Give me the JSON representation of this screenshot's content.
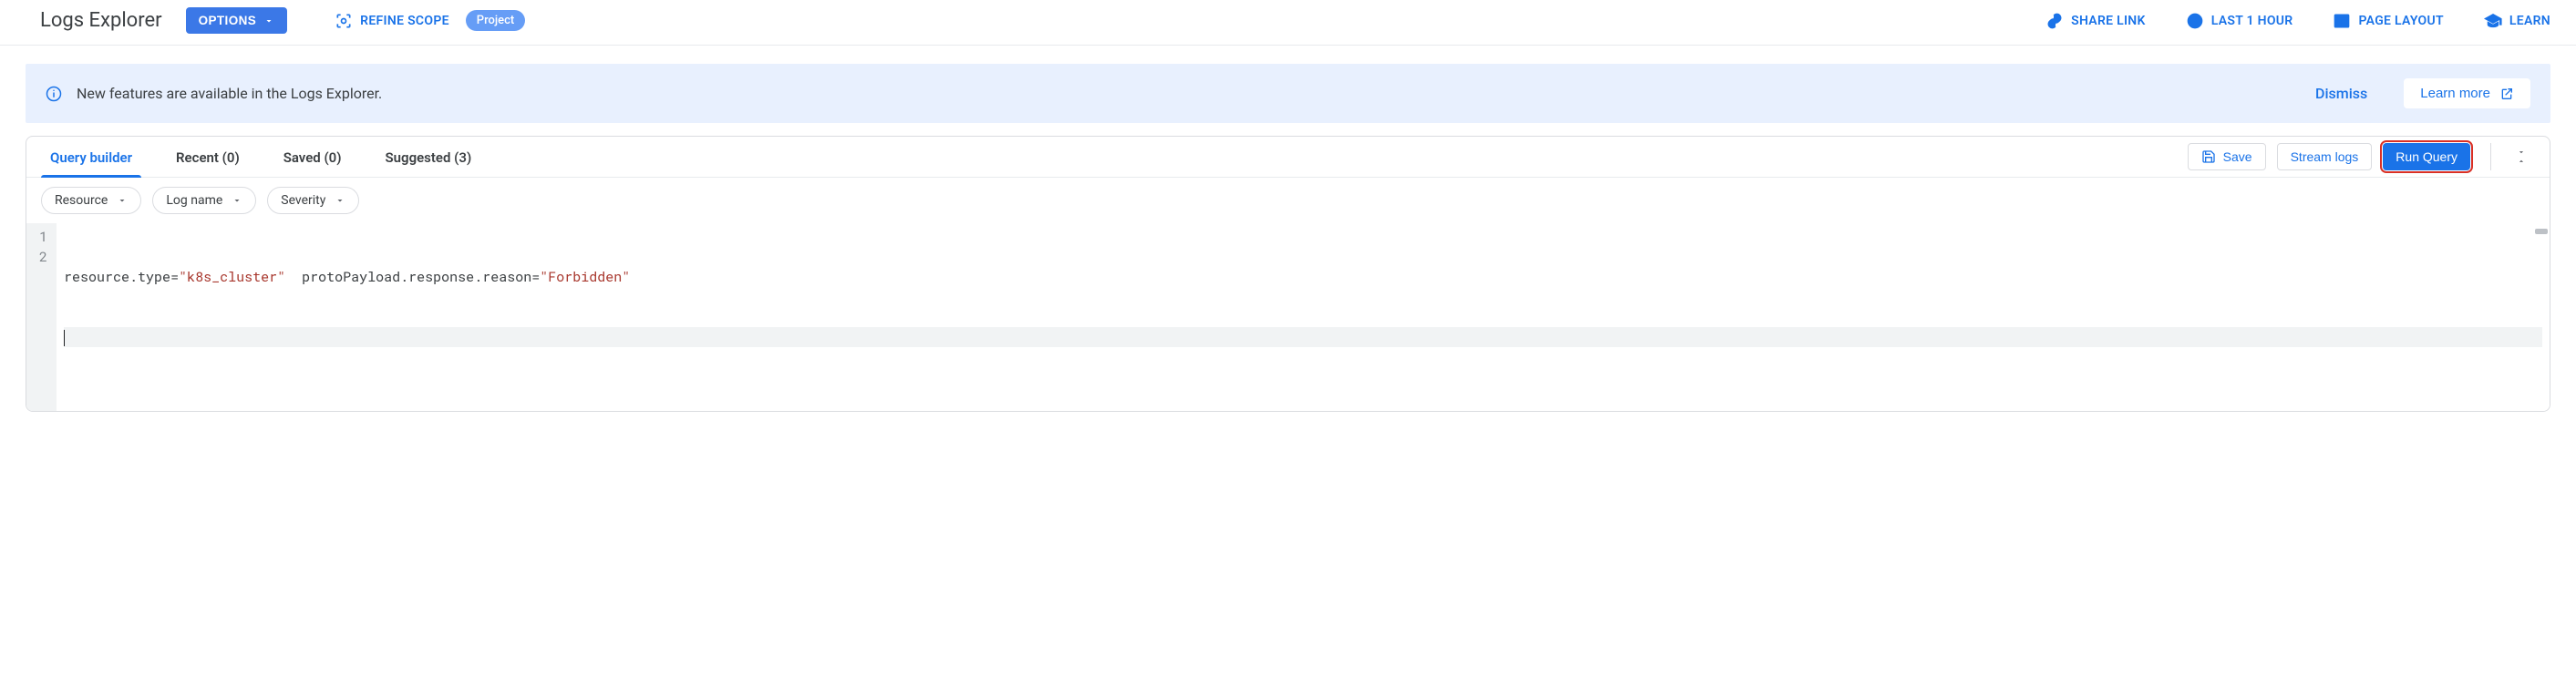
{
  "header": {
    "title": "Logs Explorer",
    "options_label": "OPTIONS",
    "refine_label": "REFINE SCOPE",
    "scope_chip": "Project",
    "actions": {
      "share": "SHARE LINK",
      "time": "LAST 1 HOUR",
      "layout": "PAGE LAYOUT",
      "learn": "LEARN"
    }
  },
  "notice": {
    "text": "New features are available in the Logs Explorer.",
    "dismiss": "Dismiss",
    "learn_more": "Learn more"
  },
  "tabs": {
    "builder": "Query builder",
    "recent": "Recent (0)",
    "saved": "Saved (0)",
    "suggested": "Suggested (3)"
  },
  "tab_actions": {
    "save": "Save",
    "stream": "Stream logs",
    "run": "Run Query"
  },
  "filters": {
    "resource": "Resource",
    "logname": "Log name",
    "severity": "Severity"
  },
  "editor": {
    "line_numbers": [
      "1",
      "2"
    ],
    "tokens": [
      {
        "t": "key",
        "v": "resource"
      },
      {
        "t": "op",
        "v": "."
      },
      {
        "t": "key",
        "v": "type"
      },
      {
        "t": "op",
        "v": "="
      },
      {
        "t": "str",
        "v": "\"k8s_cluster\""
      },
      {
        "t": "sp",
        "v": "  "
      },
      {
        "t": "key",
        "v": "protoPayload"
      },
      {
        "t": "op",
        "v": "."
      },
      {
        "t": "key",
        "v": "response"
      },
      {
        "t": "op",
        "v": "."
      },
      {
        "t": "key",
        "v": "reason"
      },
      {
        "t": "op",
        "v": "="
      },
      {
        "t": "str",
        "v": "\"Forbidden\""
      }
    ]
  }
}
